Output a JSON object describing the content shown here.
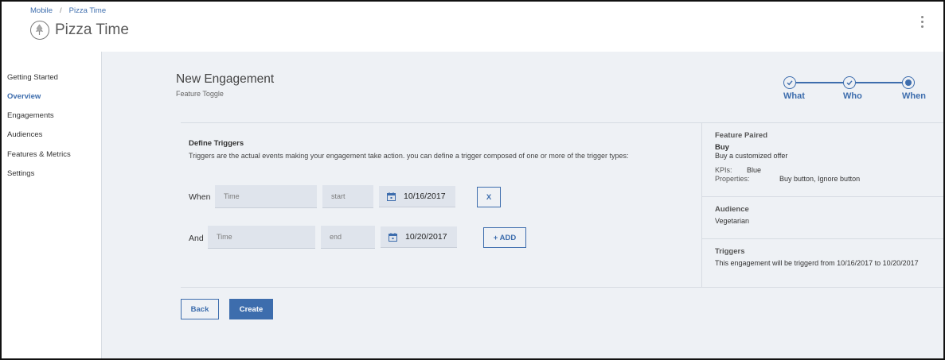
{
  "breadcrumb": {
    "parent": "Mobile",
    "separator": "/",
    "current": "Pizza Time"
  },
  "app": {
    "title": "Pizza Time"
  },
  "sidebar": {
    "items": [
      {
        "label": "Getting Started",
        "active": false
      },
      {
        "label": "Overview",
        "active": true
      },
      {
        "label": "Engagements",
        "active": false
      },
      {
        "label": "Audiences",
        "active": false
      },
      {
        "label": "Features & Metrics",
        "active": false
      },
      {
        "label": "Settings",
        "active": false
      }
    ]
  },
  "engagement": {
    "title": "New Engagement",
    "subtitle": "Feature Toggle"
  },
  "steps": [
    {
      "label": "What",
      "state": "done"
    },
    {
      "label": "Who",
      "state": "done"
    },
    {
      "label": "When",
      "state": "current"
    }
  ],
  "triggers_form": {
    "title": "Define Triggers",
    "description": "Triggers are the actual events making your engagement take action. you can define a trigger composed of one or more of the trigger types:",
    "rows": [
      {
        "label": "When",
        "type_placeholder": "Time",
        "position_placeholder": "start",
        "date": "10/16/2017",
        "action": "X"
      },
      {
        "label": "And",
        "type_placeholder": "Time",
        "position_placeholder": "end",
        "date": "10/20/2017",
        "action": "+ ADD"
      }
    ]
  },
  "footer": {
    "back_label": "Back",
    "create_label": "Create"
  },
  "summary": {
    "feature": {
      "title": "Feature Paired",
      "name": "Buy",
      "description": "Buy a customized offer",
      "kpis_key": "KPIs:",
      "kpis_value": "Blue",
      "properties_key": "Properties:",
      "properties_value": "Buy button, Ignore button"
    },
    "audience": {
      "title": "Audience",
      "value": "Vegetarian"
    },
    "triggers": {
      "title": "Triggers",
      "value": "This engagement will be triggerd from 10/16/2017 to 10/20/2017"
    }
  },
  "icons": {
    "logo": "tree-logo-icon",
    "menu": "kebab-menu-icon",
    "calendar": "calendar-icon",
    "check": "check-icon"
  },
  "colors": {
    "accent": "#3d6dad",
    "background": "#eef1f5",
    "field": "#dfe4ec"
  }
}
